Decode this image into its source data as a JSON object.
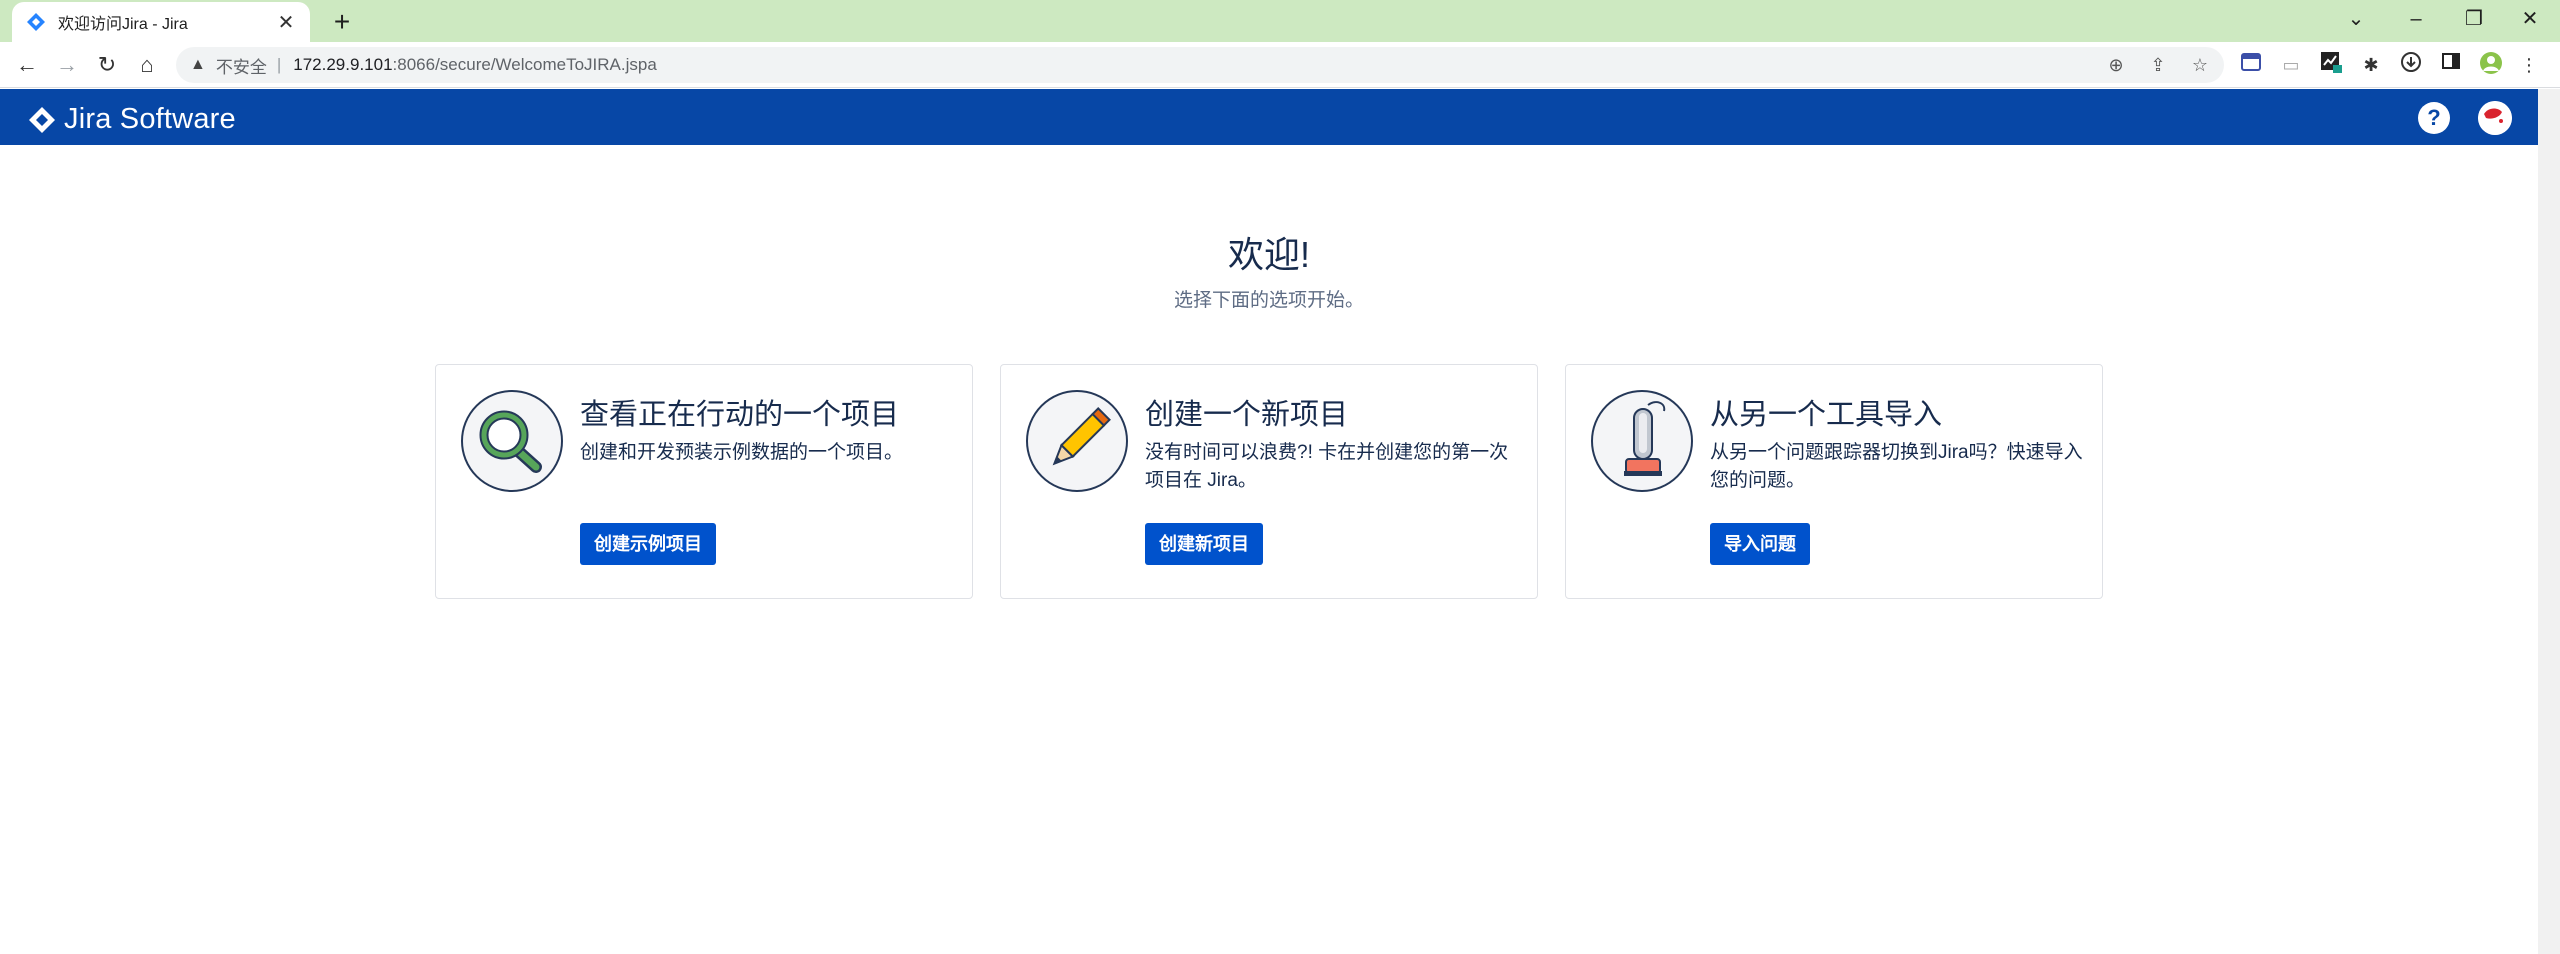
{
  "browser": {
    "tab_title": "欢迎访问Jira - Jira",
    "insecure_label": "不安全",
    "separator": "|",
    "url_host": "172.29.9.101",
    "url_rest": ":8066/secure/WelcomeToJIRA.jspa"
  },
  "header": {
    "logo_text": "Jira Software",
    "help_label": "?"
  },
  "welcome": {
    "title": "欢迎!",
    "subtitle": "选择下面的选项开始。"
  },
  "cards": [
    {
      "title": "查看正在行动的一个项目",
      "description": "创建和开发预装示例数据的一个项目。",
      "button": "创建示例项目",
      "icon": "magnifier-icon"
    },
    {
      "title": "创建一个新项目",
      "description": "没有时间可以浪费?! 卡在并创建您的第一次项目在 Jira。",
      "button": "创建新项目",
      "icon": "pencil-icon"
    },
    {
      "title": "从另一个工具导入",
      "description": "从另一个问题跟踪器切换到Jira吗？快速导入您的问题。",
      "button": "导入问题",
      "icon": "vacuum-icon"
    }
  ],
  "colors": {
    "header_bg": "#0747a6",
    "button_bg": "#0052cc",
    "tabbar_bg": "#cde9c1"
  }
}
